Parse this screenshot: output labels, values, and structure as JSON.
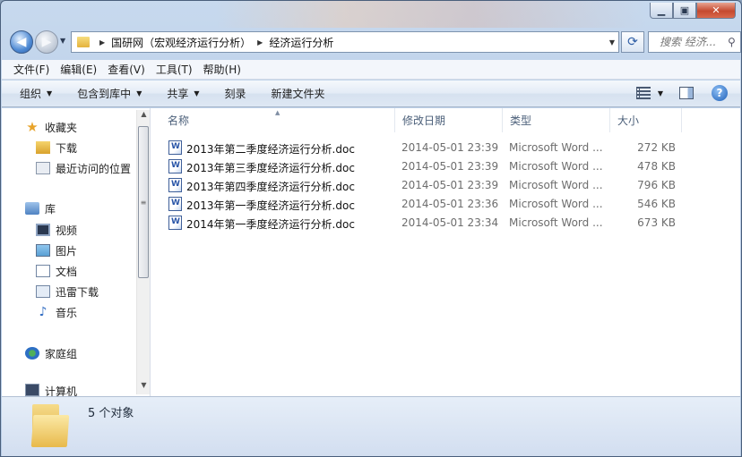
{
  "address": {
    "crumbs": [
      "国研网（宏观经济运行分析）",
      "经济运行分析"
    ],
    "search_placeholder": "搜索 经济..."
  },
  "menu": [
    "文件(F)",
    "编辑(E)",
    "查看(V)",
    "工具(T)",
    "帮助(H)"
  ],
  "toolbar": {
    "organize": "组织",
    "include_library": "包含到库中",
    "share": "共享",
    "burn": "刻录",
    "new_folder": "新建文件夹"
  },
  "nav": {
    "favorites": "收藏夹",
    "downloads": "下载",
    "recent": "最近访问的位置",
    "libraries": "库",
    "videos": "视频",
    "pictures": "图片",
    "documents": "文档",
    "thunder": "迅雷下载",
    "music": "音乐",
    "homegroup": "家庭组",
    "computer": "计算机"
  },
  "columns": {
    "name": "名称",
    "modified": "修改日期",
    "type": "类型",
    "size": "大小"
  },
  "files": [
    {
      "name": "2013年第二季度经济运行分析.doc",
      "date": "2014-05-01 23:39",
      "type": "Microsoft Word ...",
      "size": "272 KB"
    },
    {
      "name": "2013年第三季度经济运行分析.doc",
      "date": "2014-05-01 23:39",
      "type": "Microsoft Word ...",
      "size": "478 KB"
    },
    {
      "name": "2013年第四季度经济运行分析.doc",
      "date": "2014-05-01 23:39",
      "type": "Microsoft Word ...",
      "size": "796 KB"
    },
    {
      "name": "2013年第一季度经济运行分析.doc",
      "date": "2014-05-01 23:36",
      "type": "Microsoft Word ...",
      "size": "546 KB"
    },
    {
      "name": "2014年第一季度经济运行分析.doc",
      "date": "2014-05-01 23:34",
      "type": "Microsoft Word ...",
      "size": "673 KB"
    }
  ],
  "status": {
    "text": "5 个对象"
  }
}
